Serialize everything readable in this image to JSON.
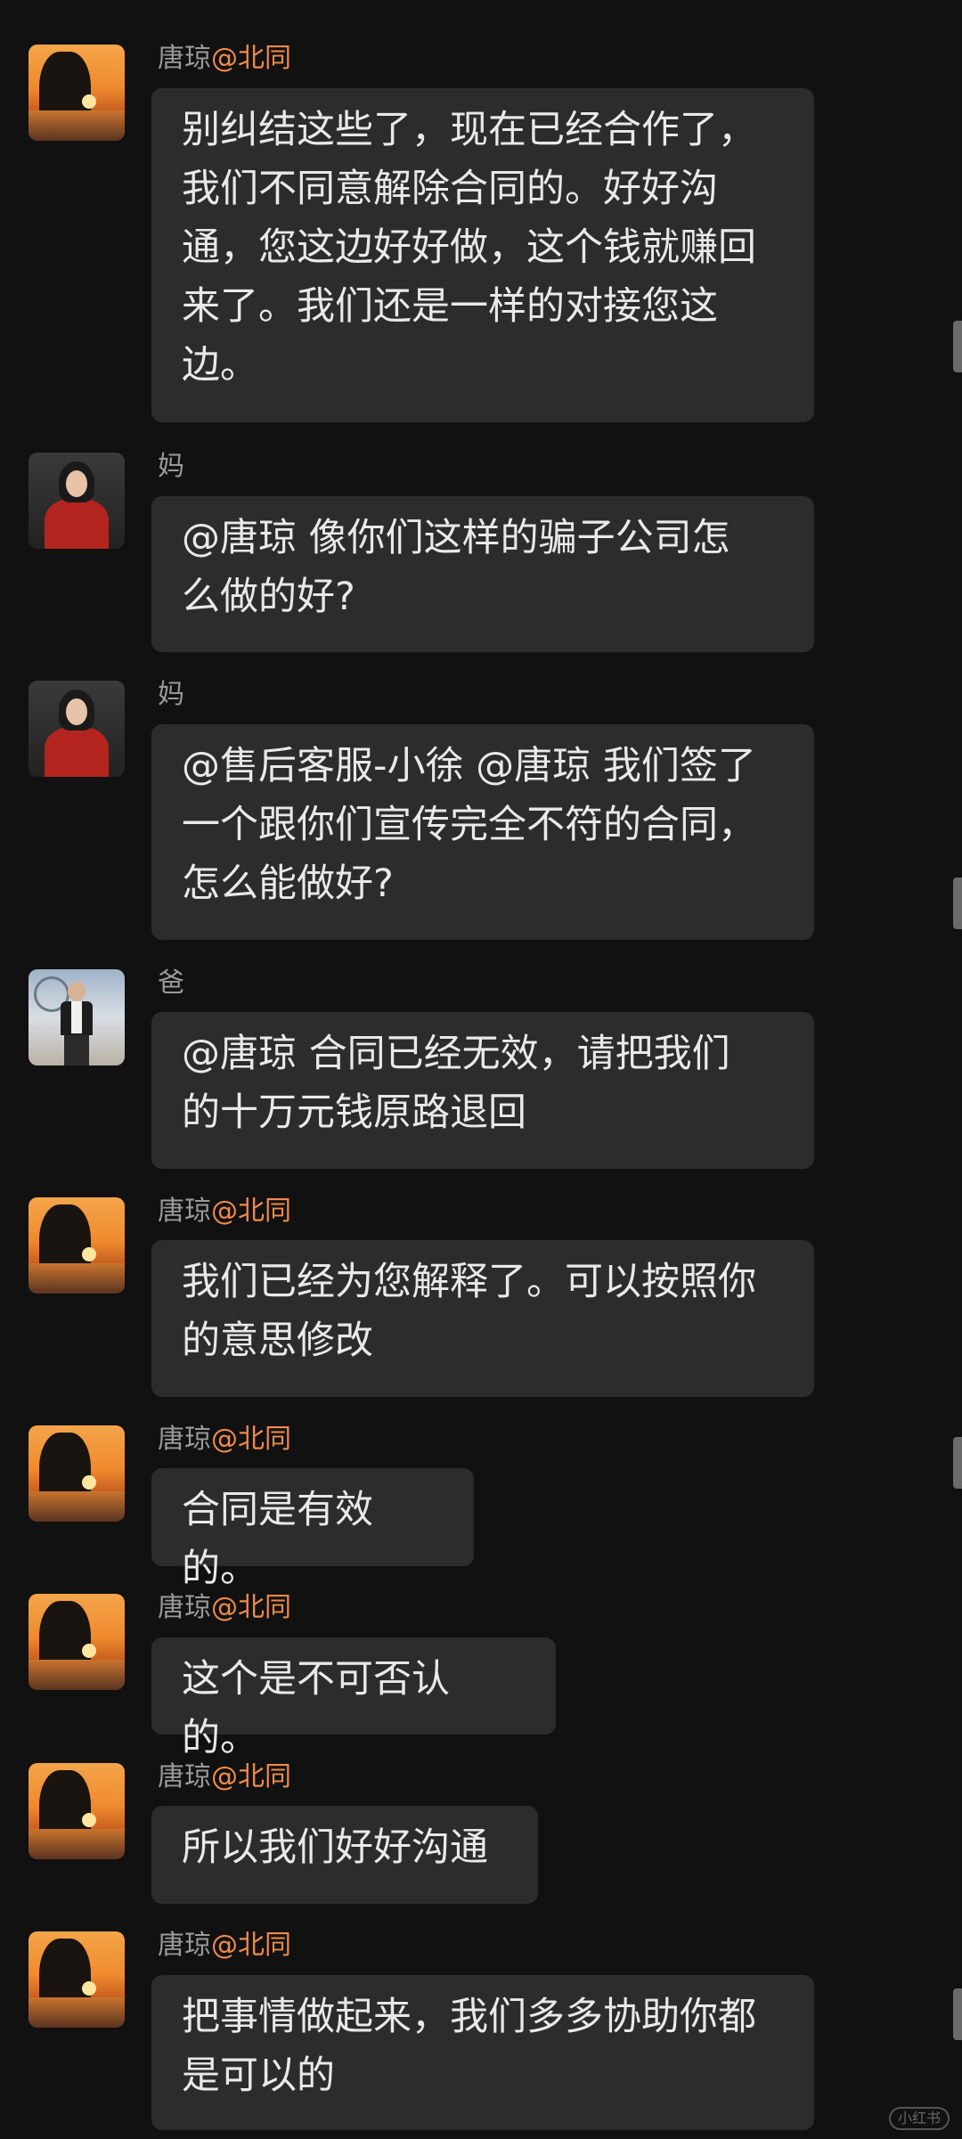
{
  "messages": [
    {
      "sender_name": "唐琼",
      "sender_org": "@北同",
      "avatar": "sunset-silhouette-avatar",
      "lines": [
        "别纠结这些了，现在已经合作了，",
        "我们不同意解除合同的。好好沟",
        "通，您这边好好做，这个钱就赚回",
        "来了。我们还是一样的对接您这",
        "边。"
      ]
    },
    {
      "sender_name": "妈",
      "sender_org": "",
      "avatar": "woman-red-top-avatar",
      "lines": [
        "@唐琼  像你们这样的骗子公司怎",
        "么做的好?"
      ]
    },
    {
      "sender_name": "妈",
      "sender_org": "",
      "avatar": "woman-red-top-avatar",
      "lines": [
        "@售后客服-小徐 @唐琼  我们签了",
        "一个跟你们宣传完全不符的合同，",
        "怎么能做好?"
      ]
    },
    {
      "sender_name": "爸",
      "sender_org": "",
      "avatar": "man-standing-avatar",
      "lines": [
        "@唐琼  合同已经无效，请把我们",
        "的十万元钱原路退回"
      ]
    },
    {
      "sender_name": "唐琼",
      "sender_org": "@北同",
      "avatar": "sunset-silhouette-avatar",
      "lines": [
        "我们已经为您解释了。可以按照你",
        "的意思修改"
      ]
    },
    {
      "sender_name": "唐琼",
      "sender_org": "@北同",
      "avatar": "sunset-silhouette-avatar",
      "lines": [
        "合同是有效的。"
      ]
    },
    {
      "sender_name": "唐琼",
      "sender_org": "@北同",
      "avatar": "sunset-silhouette-avatar",
      "lines": [
        "这个是不可否认的。"
      ]
    },
    {
      "sender_name": "唐琼",
      "sender_org": "@北同",
      "avatar": "sunset-silhouette-avatar",
      "lines": [
        "所以我们好好沟通"
      ]
    },
    {
      "sender_name": "唐琼",
      "sender_org": "@北同",
      "avatar": "sunset-silhouette-avatar",
      "lines": [
        "把事情做起来，我们多多协助你都",
        "是可以的"
      ]
    }
  ],
  "colors": {
    "background": "#111111",
    "bubble": "#2c2c2c",
    "text": "#e9e9e9",
    "sender_name": "#9a9a9a",
    "sender_org": "#ef8a49"
  },
  "watermark": "小红书"
}
